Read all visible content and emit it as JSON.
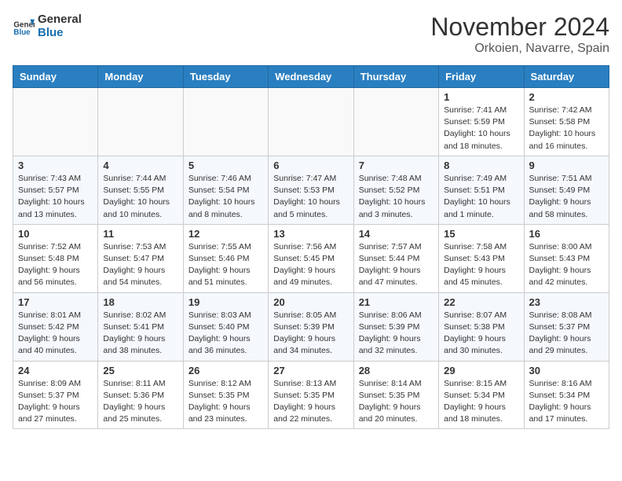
{
  "header": {
    "logo_general": "General",
    "logo_blue": "Blue",
    "month_title": "November 2024",
    "subtitle": "Orkoien, Navarre, Spain"
  },
  "days_of_week": [
    "Sunday",
    "Monday",
    "Tuesday",
    "Wednesday",
    "Thursday",
    "Friday",
    "Saturday"
  ],
  "weeks": [
    [
      {
        "num": "",
        "info": ""
      },
      {
        "num": "",
        "info": ""
      },
      {
        "num": "",
        "info": ""
      },
      {
        "num": "",
        "info": ""
      },
      {
        "num": "",
        "info": ""
      },
      {
        "num": "1",
        "info": "Sunrise: 7:41 AM\nSunset: 5:59 PM\nDaylight: 10 hours and 18 minutes."
      },
      {
        "num": "2",
        "info": "Sunrise: 7:42 AM\nSunset: 5:58 PM\nDaylight: 10 hours and 16 minutes."
      }
    ],
    [
      {
        "num": "3",
        "info": "Sunrise: 7:43 AM\nSunset: 5:57 PM\nDaylight: 10 hours and 13 minutes."
      },
      {
        "num": "4",
        "info": "Sunrise: 7:44 AM\nSunset: 5:55 PM\nDaylight: 10 hours and 10 minutes."
      },
      {
        "num": "5",
        "info": "Sunrise: 7:46 AM\nSunset: 5:54 PM\nDaylight: 10 hours and 8 minutes."
      },
      {
        "num": "6",
        "info": "Sunrise: 7:47 AM\nSunset: 5:53 PM\nDaylight: 10 hours and 5 minutes."
      },
      {
        "num": "7",
        "info": "Sunrise: 7:48 AM\nSunset: 5:52 PM\nDaylight: 10 hours and 3 minutes."
      },
      {
        "num": "8",
        "info": "Sunrise: 7:49 AM\nSunset: 5:51 PM\nDaylight: 10 hours and 1 minute."
      },
      {
        "num": "9",
        "info": "Sunrise: 7:51 AM\nSunset: 5:49 PM\nDaylight: 9 hours and 58 minutes."
      }
    ],
    [
      {
        "num": "10",
        "info": "Sunrise: 7:52 AM\nSunset: 5:48 PM\nDaylight: 9 hours and 56 minutes."
      },
      {
        "num": "11",
        "info": "Sunrise: 7:53 AM\nSunset: 5:47 PM\nDaylight: 9 hours and 54 minutes."
      },
      {
        "num": "12",
        "info": "Sunrise: 7:55 AM\nSunset: 5:46 PM\nDaylight: 9 hours and 51 minutes."
      },
      {
        "num": "13",
        "info": "Sunrise: 7:56 AM\nSunset: 5:45 PM\nDaylight: 9 hours and 49 minutes."
      },
      {
        "num": "14",
        "info": "Sunrise: 7:57 AM\nSunset: 5:44 PM\nDaylight: 9 hours and 47 minutes."
      },
      {
        "num": "15",
        "info": "Sunrise: 7:58 AM\nSunset: 5:43 PM\nDaylight: 9 hours and 45 minutes."
      },
      {
        "num": "16",
        "info": "Sunrise: 8:00 AM\nSunset: 5:43 PM\nDaylight: 9 hours and 42 minutes."
      }
    ],
    [
      {
        "num": "17",
        "info": "Sunrise: 8:01 AM\nSunset: 5:42 PM\nDaylight: 9 hours and 40 minutes."
      },
      {
        "num": "18",
        "info": "Sunrise: 8:02 AM\nSunset: 5:41 PM\nDaylight: 9 hours and 38 minutes."
      },
      {
        "num": "19",
        "info": "Sunrise: 8:03 AM\nSunset: 5:40 PM\nDaylight: 9 hours and 36 minutes."
      },
      {
        "num": "20",
        "info": "Sunrise: 8:05 AM\nSunset: 5:39 PM\nDaylight: 9 hours and 34 minutes."
      },
      {
        "num": "21",
        "info": "Sunrise: 8:06 AM\nSunset: 5:39 PM\nDaylight: 9 hours and 32 minutes."
      },
      {
        "num": "22",
        "info": "Sunrise: 8:07 AM\nSunset: 5:38 PM\nDaylight: 9 hours and 30 minutes."
      },
      {
        "num": "23",
        "info": "Sunrise: 8:08 AM\nSunset: 5:37 PM\nDaylight: 9 hours and 29 minutes."
      }
    ],
    [
      {
        "num": "24",
        "info": "Sunrise: 8:09 AM\nSunset: 5:37 PM\nDaylight: 9 hours and 27 minutes."
      },
      {
        "num": "25",
        "info": "Sunrise: 8:11 AM\nSunset: 5:36 PM\nDaylight: 9 hours and 25 minutes."
      },
      {
        "num": "26",
        "info": "Sunrise: 8:12 AM\nSunset: 5:35 PM\nDaylight: 9 hours and 23 minutes."
      },
      {
        "num": "27",
        "info": "Sunrise: 8:13 AM\nSunset: 5:35 PM\nDaylight: 9 hours and 22 minutes."
      },
      {
        "num": "28",
        "info": "Sunrise: 8:14 AM\nSunset: 5:35 PM\nDaylight: 9 hours and 20 minutes."
      },
      {
        "num": "29",
        "info": "Sunrise: 8:15 AM\nSunset: 5:34 PM\nDaylight: 9 hours and 18 minutes."
      },
      {
        "num": "30",
        "info": "Sunrise: 8:16 AM\nSunset: 5:34 PM\nDaylight: 9 hours and 17 minutes."
      }
    ]
  ]
}
